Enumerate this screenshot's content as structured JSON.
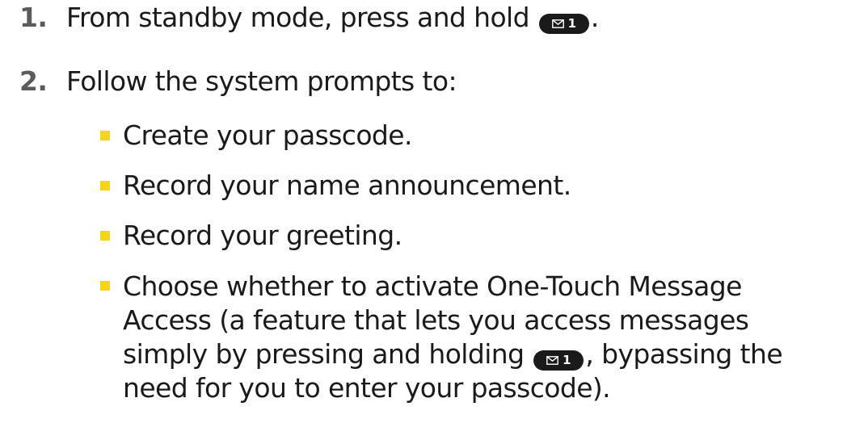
{
  "steps": [
    {
      "number": "1.",
      "text_before": "From standby mode, press and hold ",
      "key_label": "1",
      "text_after": "."
    },
    {
      "number": "2.",
      "text": "Follow the system prompts to:"
    }
  ],
  "bullets": [
    "Create your passcode.",
    "Record your name announcement.",
    "Record your greeting."
  ],
  "last_bullet": {
    "line1": "Choose whether to activate One-Touch Message",
    "line2": "Access (a feature that lets you access messages",
    "line3_before": "simply by pressing and holding ",
    "key_label": "1",
    "line3_after": ", bypassing the",
    "line4": "need for you to enter your passcode)."
  },
  "colors": {
    "bullet": "#f5d515",
    "number": "#5b5b5b",
    "key_background": "#1a1a1a"
  },
  "icons": {
    "key": "envelope-1-key-icon"
  }
}
